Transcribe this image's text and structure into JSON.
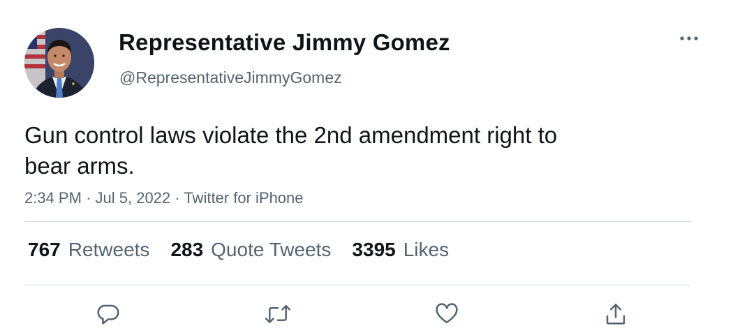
{
  "tweet": {
    "display_name": "Representative Jimmy Gomez",
    "handle": "@RepresentativeJimmyGomez",
    "text_line1": "Gun control laws violate the 2nd amendment right to",
    "text_line2": "bear arms.",
    "time": "2:34 PM",
    "date": "Jul 5, 2022",
    "source": "Twitter for iPhone",
    "separator": "·"
  },
  "stats": {
    "retweets_count": "767",
    "retweets_label": "Retweets",
    "quotes_count": "283",
    "quotes_label": "Quote Tweets",
    "likes_count": "3395",
    "likes_label": "Likes"
  },
  "icons": {
    "more": "more-horizontal-icon",
    "reply": "reply-bubble-icon",
    "retweet": "retweet-arrows-icon",
    "like": "heart-icon",
    "share": "share-upload-icon"
  },
  "colors": {
    "text_primary": "#0f1419",
    "text_secondary": "#536471",
    "divider": "#cfd9de",
    "icon": "#536471"
  }
}
